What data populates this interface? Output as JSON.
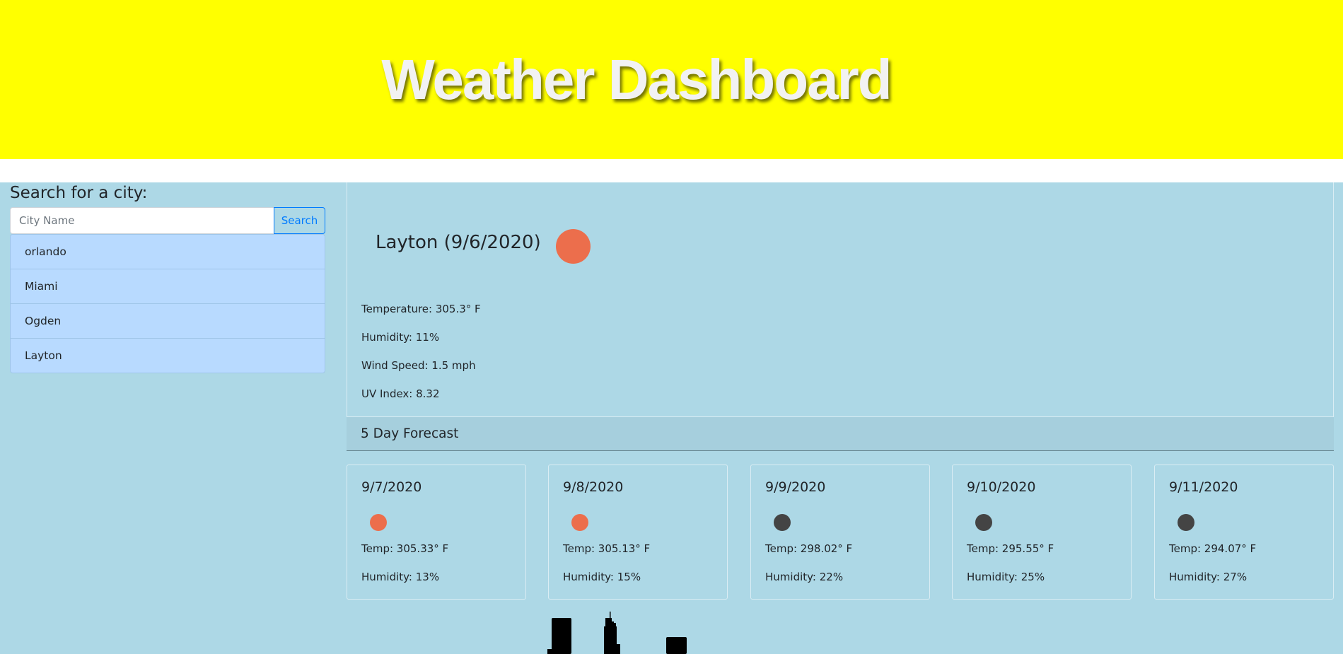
{
  "header": {
    "title": "Weather Dashboard"
  },
  "sidebar": {
    "heading": "Search for a city:",
    "search": {
      "placeholder": "City Name",
      "value": "",
      "button_label": "Search"
    },
    "history": [
      {
        "label": "orlando"
      },
      {
        "label": "Miami"
      },
      {
        "label": "Ogden"
      },
      {
        "label": "Layton"
      }
    ]
  },
  "current": {
    "title": "Layton (9/6/2020)",
    "icon": "sun-icon",
    "icon_color": "#ec6e4c",
    "temperature": "Temperature: 305.3° F",
    "humidity": "Humidity: 11%",
    "wind_speed": "Wind Speed: 1.5 mph",
    "uv_index": "UV Index: 8.32"
  },
  "forecast": {
    "heading": "5 Day Forecast",
    "days": [
      {
        "date": "9/7/2020",
        "icon": "sun-icon",
        "icon_color": "#ec6e4c",
        "temp": "Temp: 305.33° F",
        "humidity": "Humidity: 13%"
      },
      {
        "date": "9/8/2020",
        "icon": "sun-icon",
        "icon_color": "#ec6e4c",
        "temp": "Temp: 305.13° F",
        "humidity": "Humidity: 15%"
      },
      {
        "date": "9/9/2020",
        "icon": "cloud-icon",
        "icon_color": "#444444",
        "temp": "Temp: 298.02° F",
        "humidity": "Humidity: 22%"
      },
      {
        "date": "9/10/2020",
        "icon": "cloud-icon",
        "icon_color": "#444444",
        "temp": "Temp: 295.55° F",
        "humidity": "Humidity: 25%"
      },
      {
        "date": "9/11/2020",
        "icon": "cloud-icon",
        "icon_color": "#444444",
        "temp": "Temp: 294.07° F",
        "humidity": "Humidity: 27%"
      }
    ]
  },
  "colors": {
    "header_bg": "#ffff00",
    "page_bg": "#add8e6",
    "history_bg": "#b8daff",
    "accent": "#007bff"
  }
}
